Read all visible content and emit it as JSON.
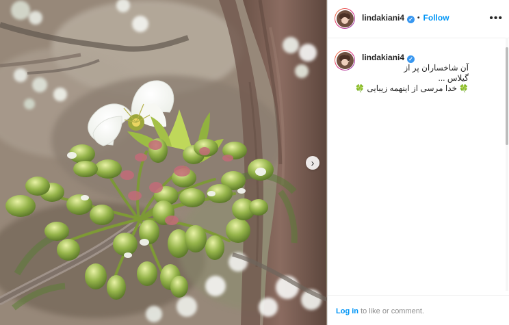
{
  "post": {
    "username": "lindakiani4",
    "verified": true,
    "follow_label": "Follow",
    "more_label": "•••",
    "caption_lines": [
      "آن شاخساران پر از",
      "گیلاس ...",
      "خدا مرسی از اینهمه زیبایی"
    ],
    "caption_emoji": "🍀"
  },
  "footer": {
    "login_label": "Log in",
    "text": "to like or comment."
  },
  "colors": {
    "accent": "#0095f6",
    "verified": "#3897f0",
    "clover": "#2f9e44"
  },
  "icons": {
    "verified": "verified-icon",
    "more": "more-icon",
    "next": "chevron-right-icon"
  },
  "carousel": {
    "next_label": "›"
  }
}
